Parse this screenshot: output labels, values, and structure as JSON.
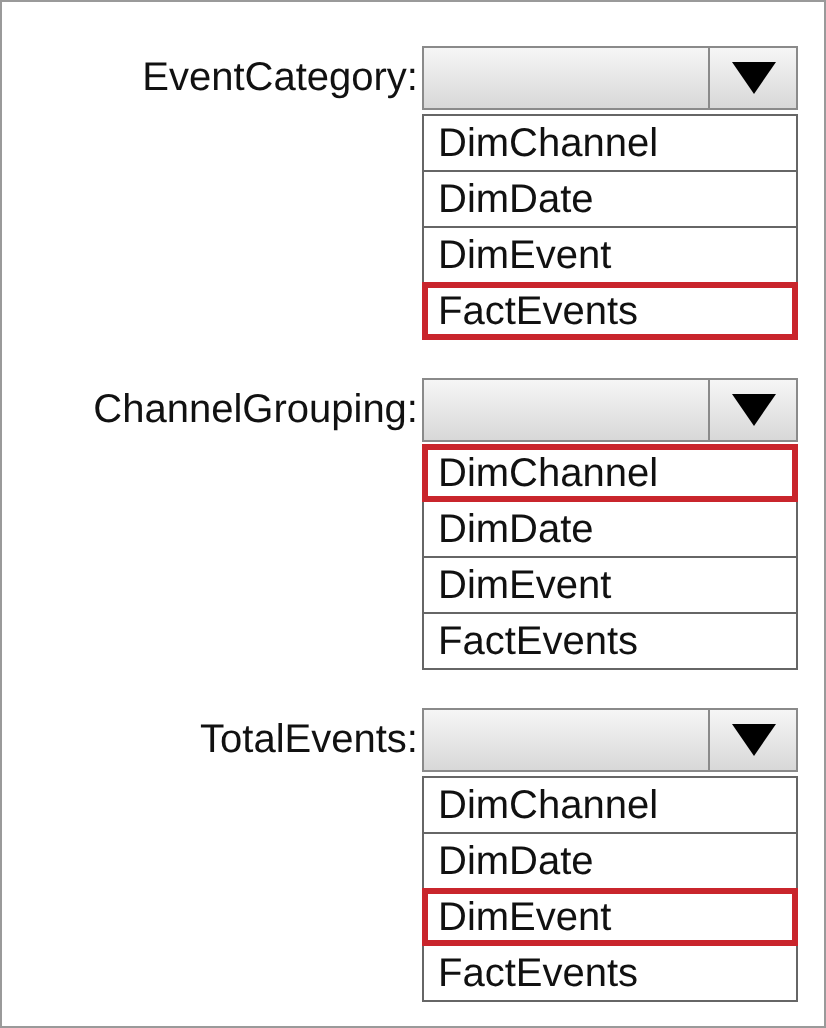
{
  "fields": [
    {
      "label": "EventCategory:",
      "options": [
        {
          "label": "DimChannel",
          "selected": false
        },
        {
          "label": "DimDate",
          "selected": false
        },
        {
          "label": "DimEvent",
          "selected": false
        },
        {
          "label": "FactEvents",
          "selected": true
        }
      ]
    },
    {
      "label": "ChannelGrouping:",
      "options": [
        {
          "label": "DimChannel",
          "selected": true
        },
        {
          "label": "DimDate",
          "selected": false
        },
        {
          "label": "DimEvent",
          "selected": false
        },
        {
          "label": "FactEvents",
          "selected": false
        }
      ]
    },
    {
      "label": "TotalEvents:",
      "options": [
        {
          "label": "DimChannel",
          "selected": false
        },
        {
          "label": "DimDate",
          "selected": false
        },
        {
          "label": "DimEvent",
          "selected": true
        },
        {
          "label": "FactEvents",
          "selected": false
        }
      ]
    }
  ]
}
